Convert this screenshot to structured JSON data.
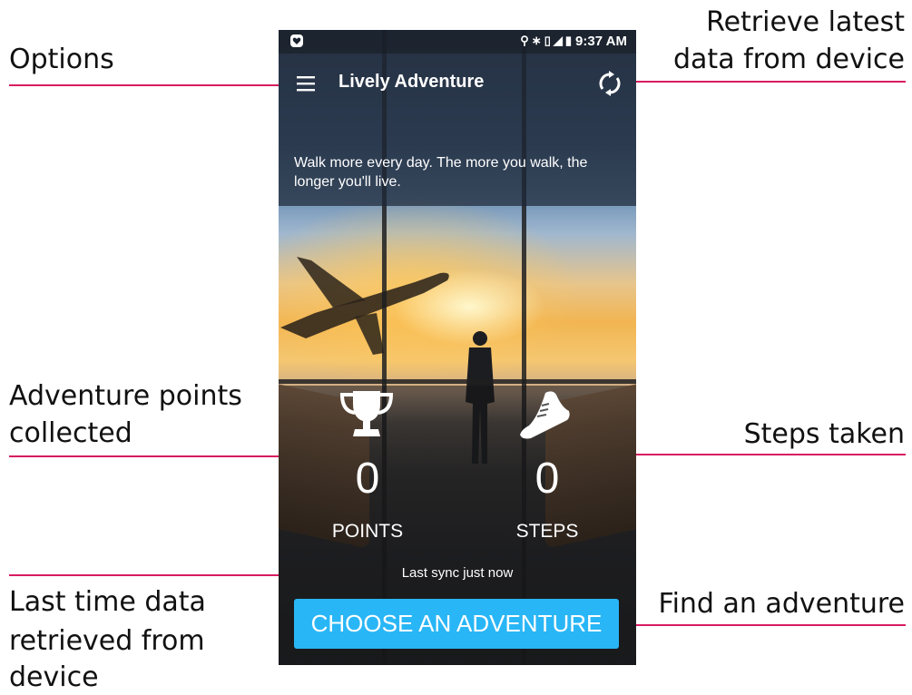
{
  "annotations": {
    "options": "Options",
    "retrieve_line1": "Retrieve latest",
    "retrieve_line2": "data from device",
    "points_line1": "Adventure points",
    "points_line2": "collected",
    "steps": "Steps taken",
    "last_time_line1": "Last time data",
    "last_time_line2": "retrieved from",
    "last_time_line3": "device",
    "find": "Find an adventure",
    "line_color": "#d81b60"
  },
  "status_bar": {
    "time": "9:37 AM",
    "icons": [
      "location-icon",
      "bluetooth-icon",
      "vibrate-icon",
      "signal-icon",
      "battery-icon"
    ]
  },
  "app_bar": {
    "title": "Lively Adventure",
    "menu_icon": "hamburger-menu-icon",
    "sync_icon": "sync-icon"
  },
  "tagline": "Walk more every day. The more you walk, the longer you'll live.",
  "stats": {
    "points": {
      "value": "0",
      "label": "POINTS",
      "icon": "trophy-icon"
    },
    "steps": {
      "value": "0",
      "label": "STEPS",
      "icon": "shoe-icon"
    }
  },
  "last_sync": "Last sync just now",
  "cta": {
    "label": "CHOOSE AN ADVENTURE",
    "color": "#29b6f6"
  }
}
